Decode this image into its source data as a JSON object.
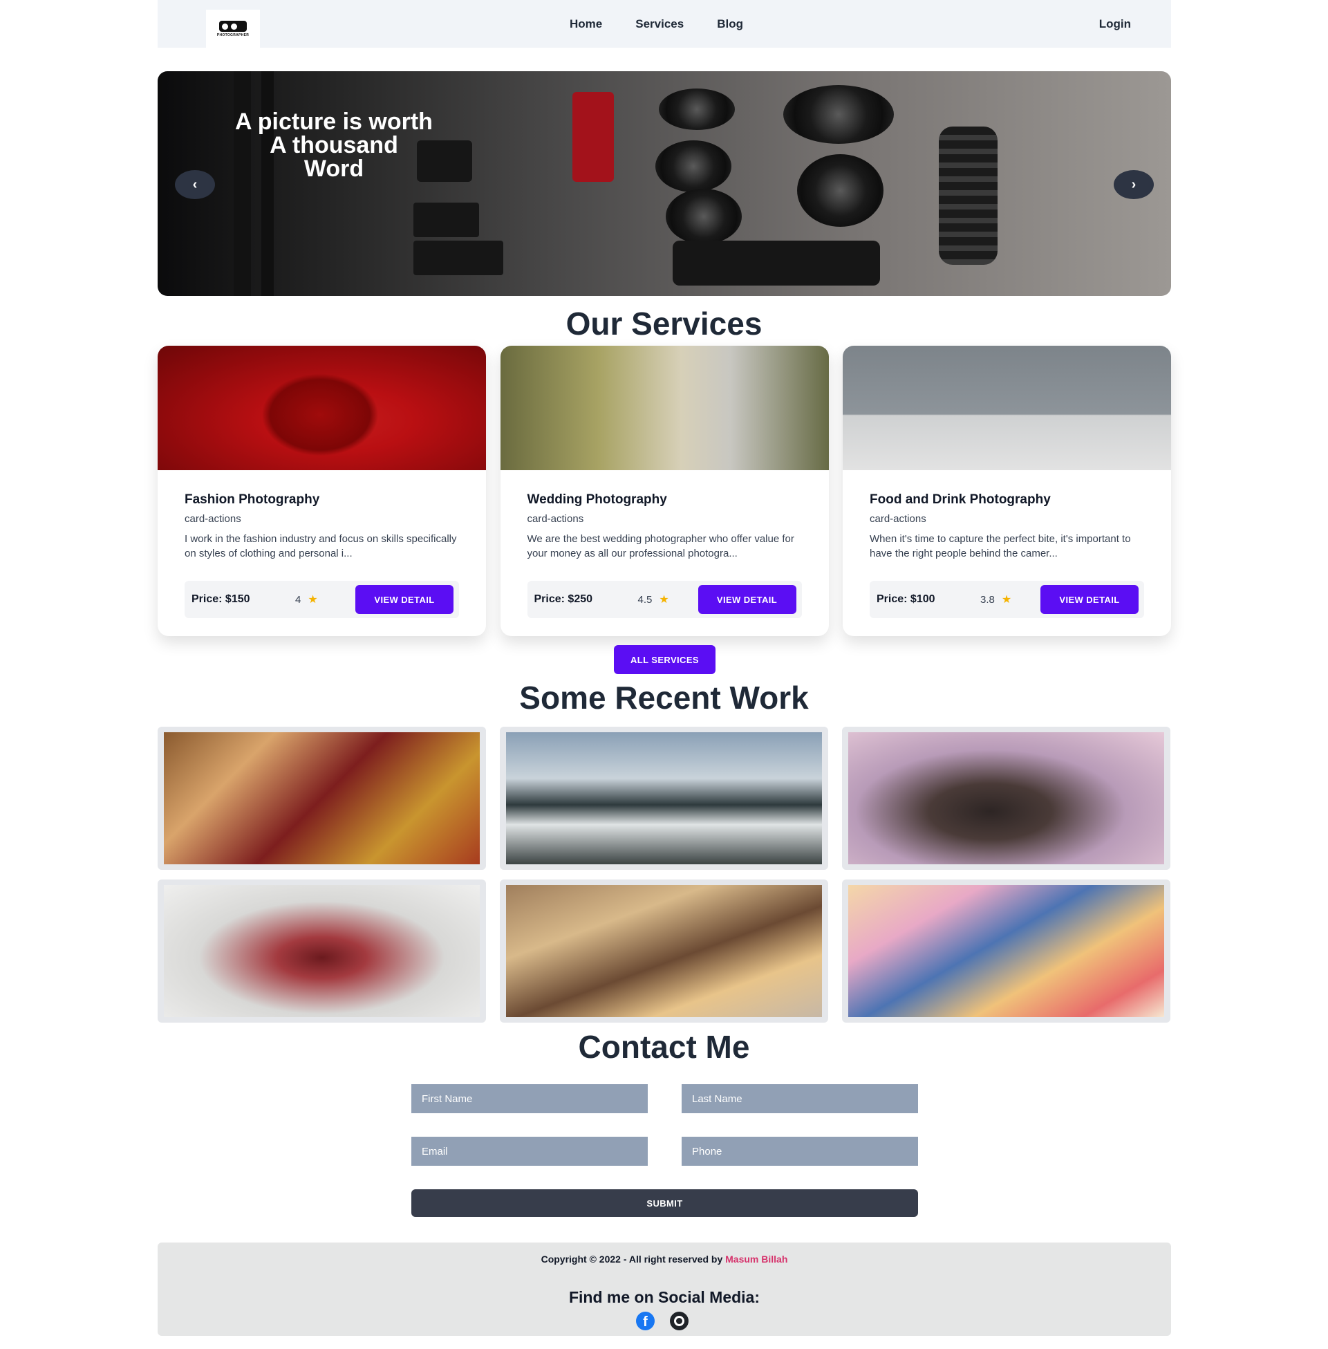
{
  "nav": {
    "logo_text": "PHOTOGRAPHER",
    "links": [
      "Home",
      "Services",
      "Blog"
    ],
    "login": "Login"
  },
  "hero": {
    "title_line1": "A picture is worth",
    "title_line2": "A thousand",
    "title_line3": "Word",
    "prev": "‹",
    "next": "›"
  },
  "services": {
    "heading": "Our Services",
    "cards": [
      {
        "title": "Fashion Photography",
        "subtitle": "card-actions",
        "description": "I work in the fashion industry and focus on skills specifically on styles of clothing and personal i...",
        "price": "Price: $150",
        "rating": "4",
        "button": "VIEW DETAIL"
      },
      {
        "title": "Wedding Photography",
        "subtitle": "card-actions",
        "description": "We are the best wedding photographer who offer value for your money as all our professional photogra...",
        "price": "Price: $250",
        "rating": "4.5",
        "button": "VIEW DETAIL"
      },
      {
        "title": "Food and Drink Photography",
        "subtitle": "card-actions",
        "description": "When it's time to capture the perfect bite, it's important to have the right people behind the camer...",
        "price": "Price: $100",
        "rating": "3.8",
        "button": "VIEW DETAIL"
      }
    ],
    "all_button": "ALL SERVICES"
  },
  "recent_work": {
    "heading": "Some Recent Work"
  },
  "contact": {
    "heading": "Contact Me",
    "first_name_placeholder": "First Name",
    "last_name_placeholder": "Last Name",
    "email_placeholder": "Email",
    "phone_placeholder": "Phone",
    "submit": "SUBMIT"
  },
  "footer": {
    "copyright": "Copyright © 2022 - All right reserved by ",
    "author": "Masum Billah",
    "social_title": "Find me on Social Media:"
  },
  "colors": {
    "accent": "#5b0ef3",
    "nav_bg": "#f1f4f8",
    "input_bg": "#91a0b5",
    "submit_bg": "#373d4b",
    "author_color": "#d6336c"
  }
}
